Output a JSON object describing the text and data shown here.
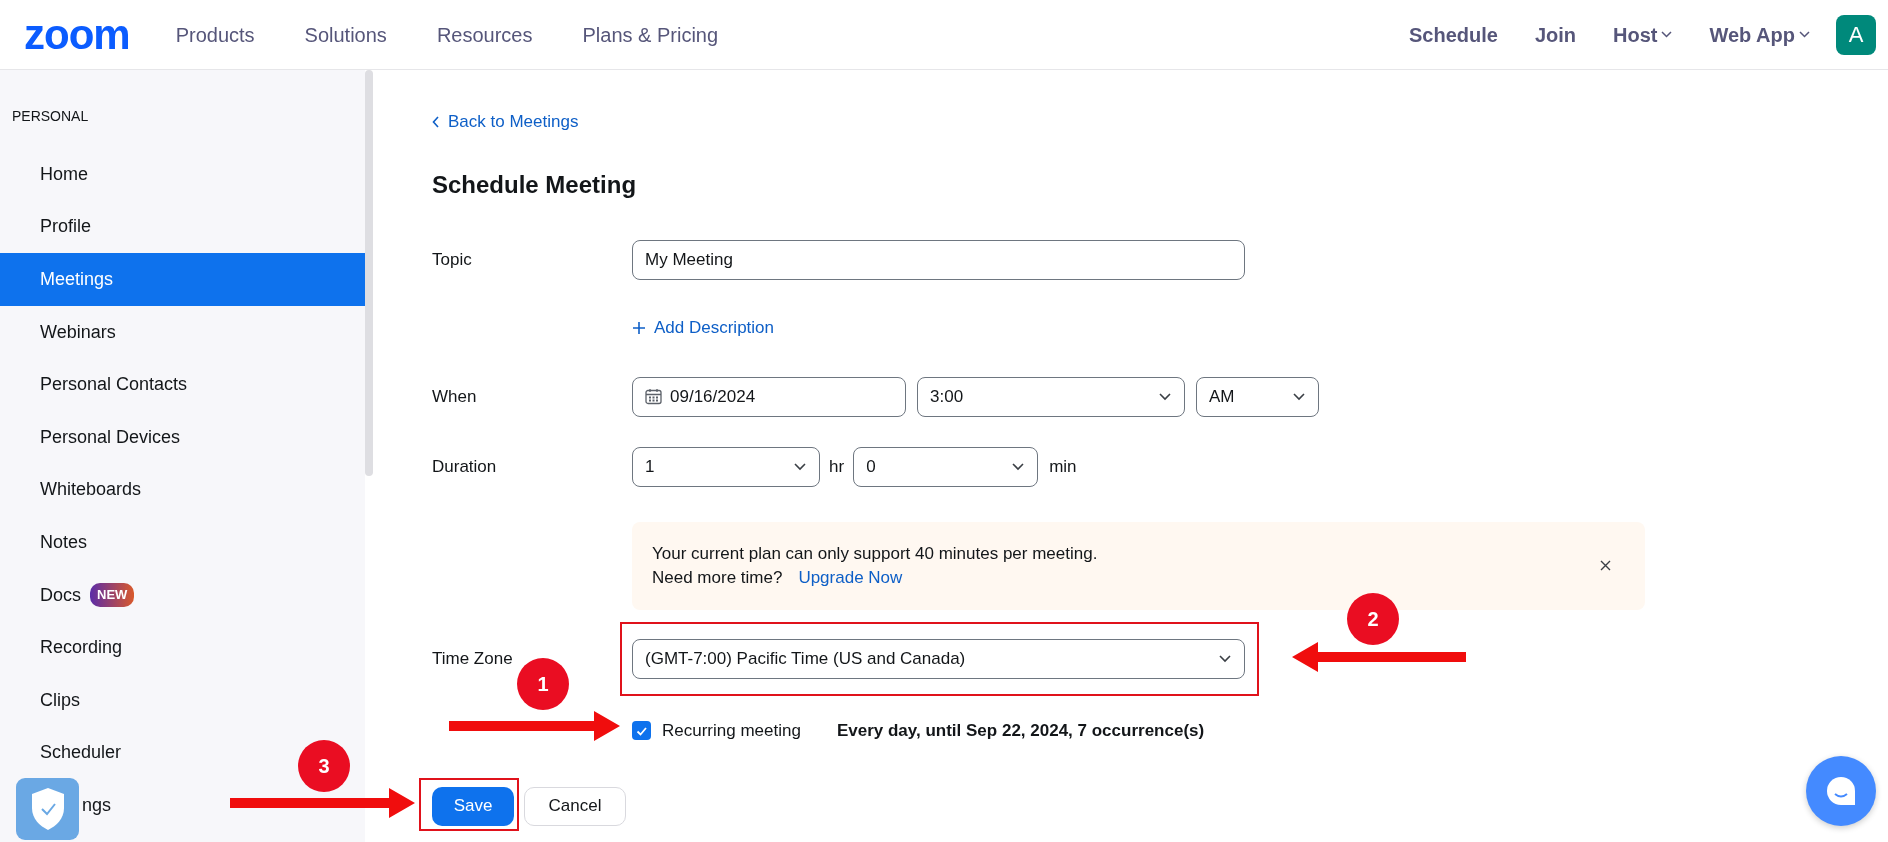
{
  "header": {
    "logo": "zoom",
    "nav": [
      "Products",
      "Solutions",
      "Resources",
      "Plans & Pricing"
    ],
    "right_nav": [
      {
        "label": "Schedule",
        "dropdown": false
      },
      {
        "label": "Join",
        "dropdown": false
      },
      {
        "label": "Host",
        "dropdown": true
      },
      {
        "label": "Web App",
        "dropdown": true
      }
    ],
    "avatar": "A"
  },
  "sidebar": {
    "section": "PERSONAL",
    "items": [
      {
        "label": "Home",
        "selected": false
      },
      {
        "label": "Profile",
        "selected": false
      },
      {
        "label": "Meetings",
        "selected": true
      },
      {
        "label": "Webinars",
        "selected": false
      },
      {
        "label": "Personal Contacts",
        "selected": false
      },
      {
        "label": "Personal Devices",
        "selected": false
      },
      {
        "label": "Whiteboards",
        "selected": false
      },
      {
        "label": "Notes",
        "selected": false
      },
      {
        "label": "Docs",
        "selected": false,
        "badge": "NEW"
      },
      {
        "label": "Recording",
        "selected": false
      },
      {
        "label": "Clips",
        "selected": false
      },
      {
        "label": "Scheduler",
        "selected": false
      },
      {
        "label": "ngs",
        "selected": false,
        "covered": true
      }
    ]
  },
  "form": {
    "back_link": "Back to Meetings",
    "title": "Schedule Meeting",
    "topic": {
      "label": "Topic",
      "value": "My Meeting"
    },
    "add_description": "Add Description",
    "when": {
      "label": "When",
      "date": "09/16/2024",
      "time": "3:00",
      "period": "AM"
    },
    "duration": {
      "label": "Duration",
      "hours": "1",
      "hours_unit": "hr",
      "minutes": "0",
      "minutes_unit": "min"
    },
    "notice": {
      "text": "Your current plan can only support 40 minutes per meeting.",
      "question": "Need more time?",
      "link": "Upgrade Now"
    },
    "time_zone": {
      "label": "Time Zone",
      "value": "(GMT-7:00) Pacific Time (US and Canada)",
      "outlined": true
    },
    "recurring": {
      "label": "Recurring meeting",
      "checked": true,
      "summary": "Every day, until Sep 22, 2024, 7 occurrence(s)"
    },
    "buttons": [
      {
        "label": "Save",
        "kind": "primary",
        "outlined": true
      },
      {
        "label": "Cancel",
        "kind": "secondary",
        "outlined": false
      }
    ]
  },
  "annotations": [
    {
      "label": "1",
      "kind": "right"
    },
    {
      "label": "2",
      "kind": "left"
    },
    {
      "label": "3",
      "kind": "right"
    }
  ]
}
